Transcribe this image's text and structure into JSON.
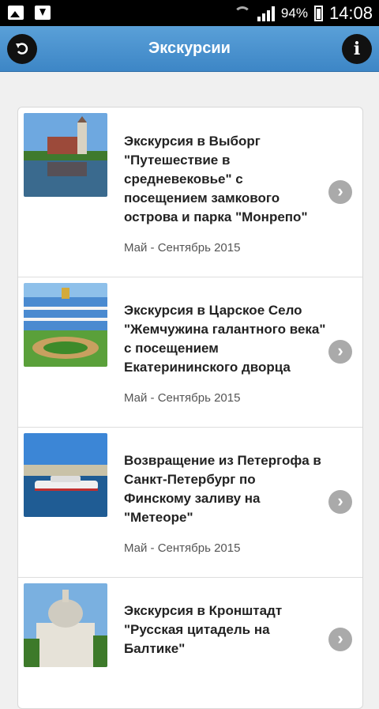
{
  "status_bar": {
    "battery": "94%",
    "time": "14:08"
  },
  "header": {
    "title": "Экскурсии"
  },
  "excursions": [
    {
      "title": "Экскурсия в Выборг \"Путешествие в средневековье\" с посещением замкового острова и парка \"Монрепо\"",
      "date": "Май - Сентябрь 2015"
    },
    {
      "title": "Экскурсия в Царское Село \"Жемчужина галантного века\" с посещением Екатерининского дворца",
      "date": "Май - Сентябрь 2015"
    },
    {
      "title": "Возвращение из Петергофа в Санкт-Петербург по Финскому заливу на \"Метеоре\"",
      "date": "Май - Сентябрь 2015"
    },
    {
      "title": "Экскурсия в Кронштадт \"Русская цитадель на Балтике\"",
      "date": ""
    }
  ]
}
